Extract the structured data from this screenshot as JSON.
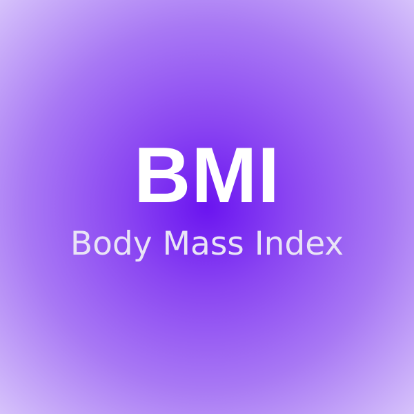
{
  "background": {
    "center_color": "#6a14f0",
    "edge_color": "#d6c2fb"
  },
  "title": {
    "acronym": "BMI",
    "full_name": "Body Mass Index",
    "acronym_color": "#ffffff",
    "full_name_color": "#e9e4f6"
  }
}
